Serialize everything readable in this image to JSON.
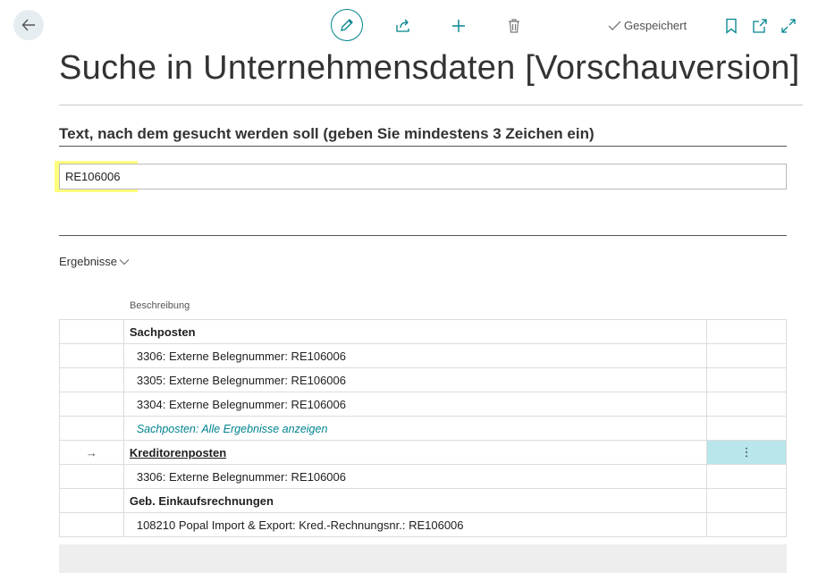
{
  "toolbar": {
    "status_text": "Gespeichert",
    "icons": [
      "back-arrow-icon",
      "edit-pencil-icon",
      "share-icon",
      "plus-icon",
      "trash-icon",
      "checkmark-icon",
      "bookmark-icon",
      "open-new-window-icon",
      "expand-icon"
    ]
  },
  "page": {
    "title": "Suche in Unternehmensdaten [Vorschauversion]"
  },
  "search": {
    "label": "Text, nach dem gesucht werden soll (geben Sie mindestens 3 Zeichen ein)",
    "value": "RE106006"
  },
  "results": {
    "label": "Ergebnisse",
    "column_header": "Beschreibung",
    "rows": [
      {
        "text": "Sachposten"
      },
      {
        "text": "3306: Externe Belegnummer: RE106006"
      },
      {
        "text": "3305: Externe Belegnummer: RE106006"
      },
      {
        "text": "3304: Externe Belegnummer: RE106006"
      },
      {
        "text": "Sachposten: Alle Ergebnisse anzeigen"
      },
      {
        "text": "Kreditorenposten",
        "marker": "→",
        "menu": "⋮"
      },
      {
        "text": "3306: Externe Belegnummer: RE106006"
      },
      {
        "text": "Geb. Einkaufsrechnungen"
      },
      {
        "text": "108210 Popal Import & Export: Kred.-Rechnungsnr.: RE106006"
      }
    ]
  },
  "colors": {
    "accent": "#00838f",
    "selection": "#b8e6ea",
    "highlight": "#ffff66"
  }
}
